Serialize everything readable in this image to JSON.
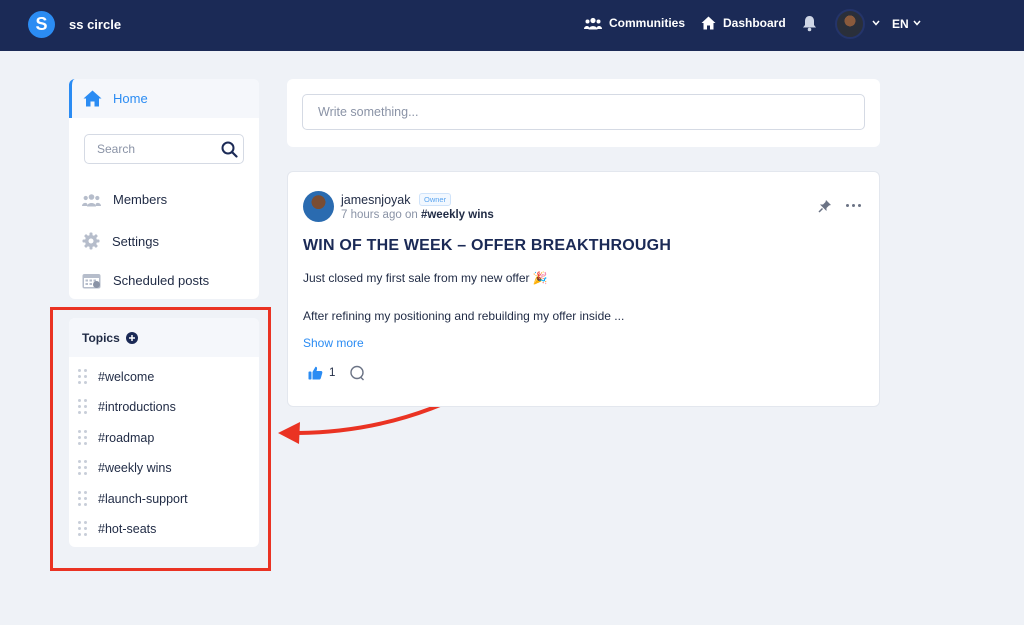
{
  "topbar": {
    "logo_letter": "S",
    "brand": "ss circle",
    "communities": "Communities",
    "dashboard": "Dashboard",
    "language": "EN"
  },
  "sidebar": {
    "home": "Home",
    "search_placeholder": "Search",
    "items": [
      {
        "label": "Members",
        "icon": "members-icon"
      },
      {
        "label": "Settings",
        "icon": "gear-icon"
      },
      {
        "label": "Scheduled posts",
        "icon": "calendar-icon"
      }
    ]
  },
  "topics": {
    "title": "Topics",
    "items": [
      "#welcome",
      "#introductions",
      "#roadmap",
      "#weekly wins",
      "#launch-support",
      "#hot-seats"
    ]
  },
  "compose": {
    "placeholder": "Write something..."
  },
  "post": {
    "author": "jamesnjoyak",
    "badge": "Owner",
    "time": "7 hours ago",
    "on": "on",
    "topic": "#weekly wins",
    "title": "WIN OF THE WEEK – OFFER BREAKTHROUGH",
    "line1": "Just closed my first sale from my new offer 🎉",
    "line2": "After refining my positioning and rebuilding my offer inside ...",
    "show_more": "Show more",
    "likes": "1"
  },
  "colors": {
    "navbar": "#1b2a56",
    "accent": "#2b8cf3",
    "highlight": "#ea3323"
  }
}
